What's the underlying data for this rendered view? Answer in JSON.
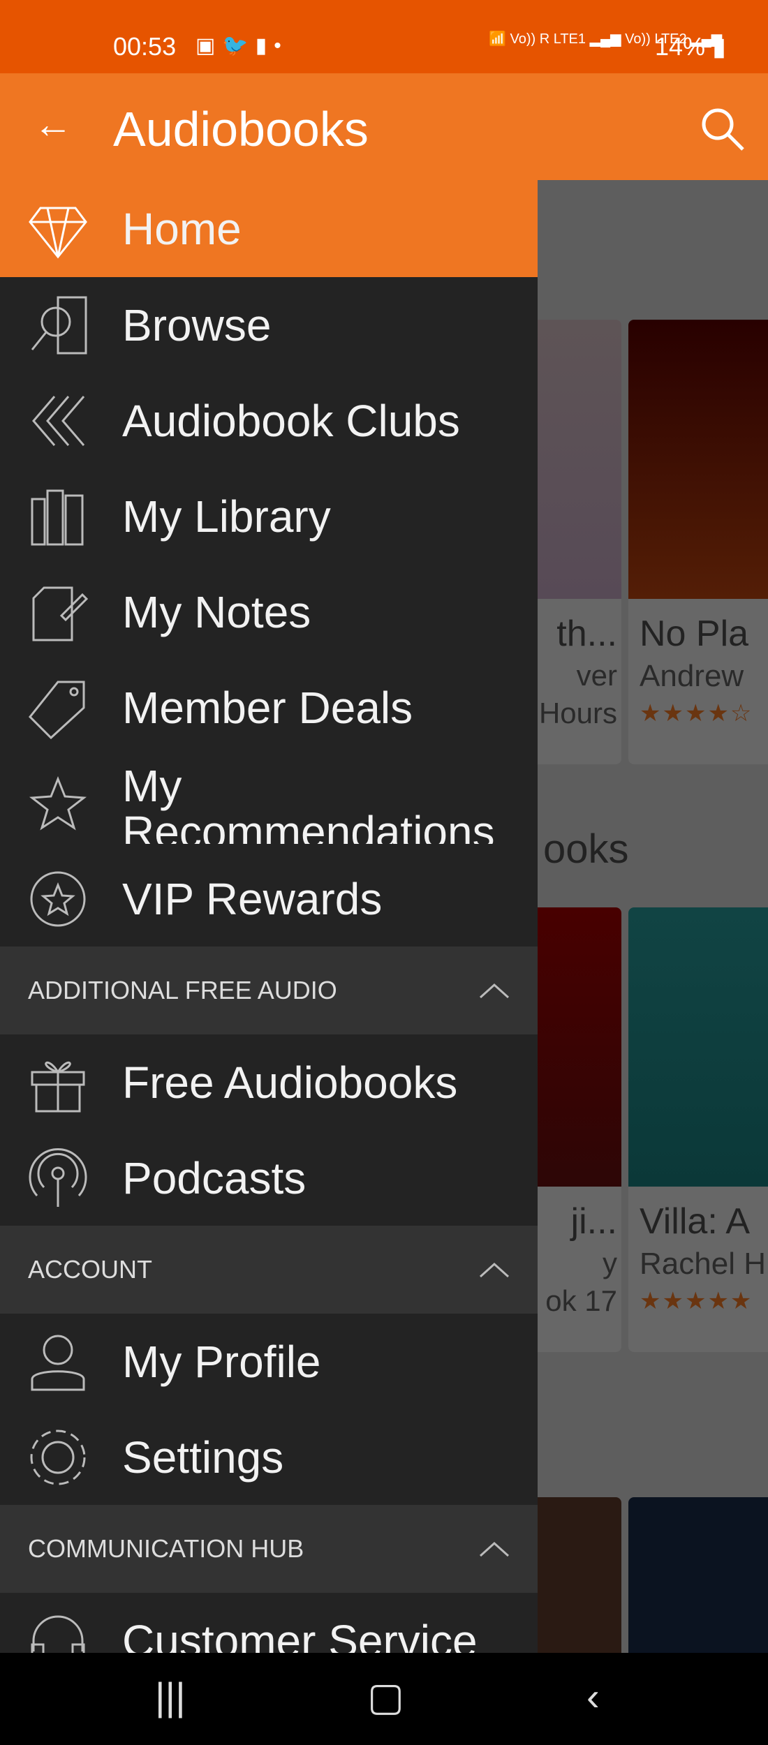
{
  "status_bar": {
    "time": "00:53",
    "notification_icons": [
      "gallery-icon",
      "twitter-icon",
      "battery-alert-icon",
      "dot-icon"
    ],
    "net1": "Vo)) R LTE1",
    "net2": "Vo)) LTE2",
    "battery": "14%"
  },
  "app_bar": {
    "title": "Audiobooks",
    "back_icon": "arrow-left-icon",
    "search_icon": "search-icon"
  },
  "colors": {
    "accent": "#ef7622",
    "status": "#e65400",
    "drawer": "#232323",
    "section": "#333333"
  },
  "drawer": {
    "main_items": [
      {
        "label": "Home",
        "icon": "diamond-icon",
        "active": true
      },
      {
        "label": "Browse",
        "icon": "browse-search-icon"
      },
      {
        "label": "Audiobook Clubs",
        "icon": "chevrons-left-icon"
      },
      {
        "label": "My Library",
        "icon": "books-icon"
      },
      {
        "label": "My Notes",
        "icon": "note-pencil-icon"
      },
      {
        "label": "Member Deals",
        "icon": "sale-tag-icon"
      },
      {
        "label": "My Recommendations",
        "icon": "star-hand-icon"
      },
      {
        "label": "VIP Rewards",
        "icon": "star-badge-icon"
      }
    ],
    "sections": [
      {
        "title": "ADDITIONAL FREE AUDIO",
        "items": [
          {
            "label": "Free Audiobooks",
            "icon": "gift-icon"
          },
          {
            "label": "Podcasts",
            "icon": "podcast-icon"
          }
        ]
      },
      {
        "title": "ACCOUNT",
        "items": [
          {
            "label": "My Profile",
            "icon": "user-icon"
          },
          {
            "label": "Settings",
            "icon": "gear-icon"
          }
        ]
      },
      {
        "title": "COMMUNICATION HUB",
        "items": [
          {
            "label": "Customer Service",
            "icon": "headset-icon"
          }
        ]
      }
    ]
  },
  "background": {
    "row1": [
      {
        "title": "th...",
        "line1": "ver",
        "line2": "Hours"
      },
      {
        "title": "No Pla",
        "line1": "Andrew",
        "rating": 4.5
      }
    ],
    "section2_title": "ooks",
    "row2": [
      {
        "title": "ji...",
        "line1": "y",
        "line2": "ok 17"
      },
      {
        "title": "Villa: A",
        "line1": "Rachel H",
        "rating": 5
      }
    ]
  },
  "nav_bar": {
    "recent": "recent-apps-icon",
    "home": "home-icon",
    "back": "back-icon"
  }
}
